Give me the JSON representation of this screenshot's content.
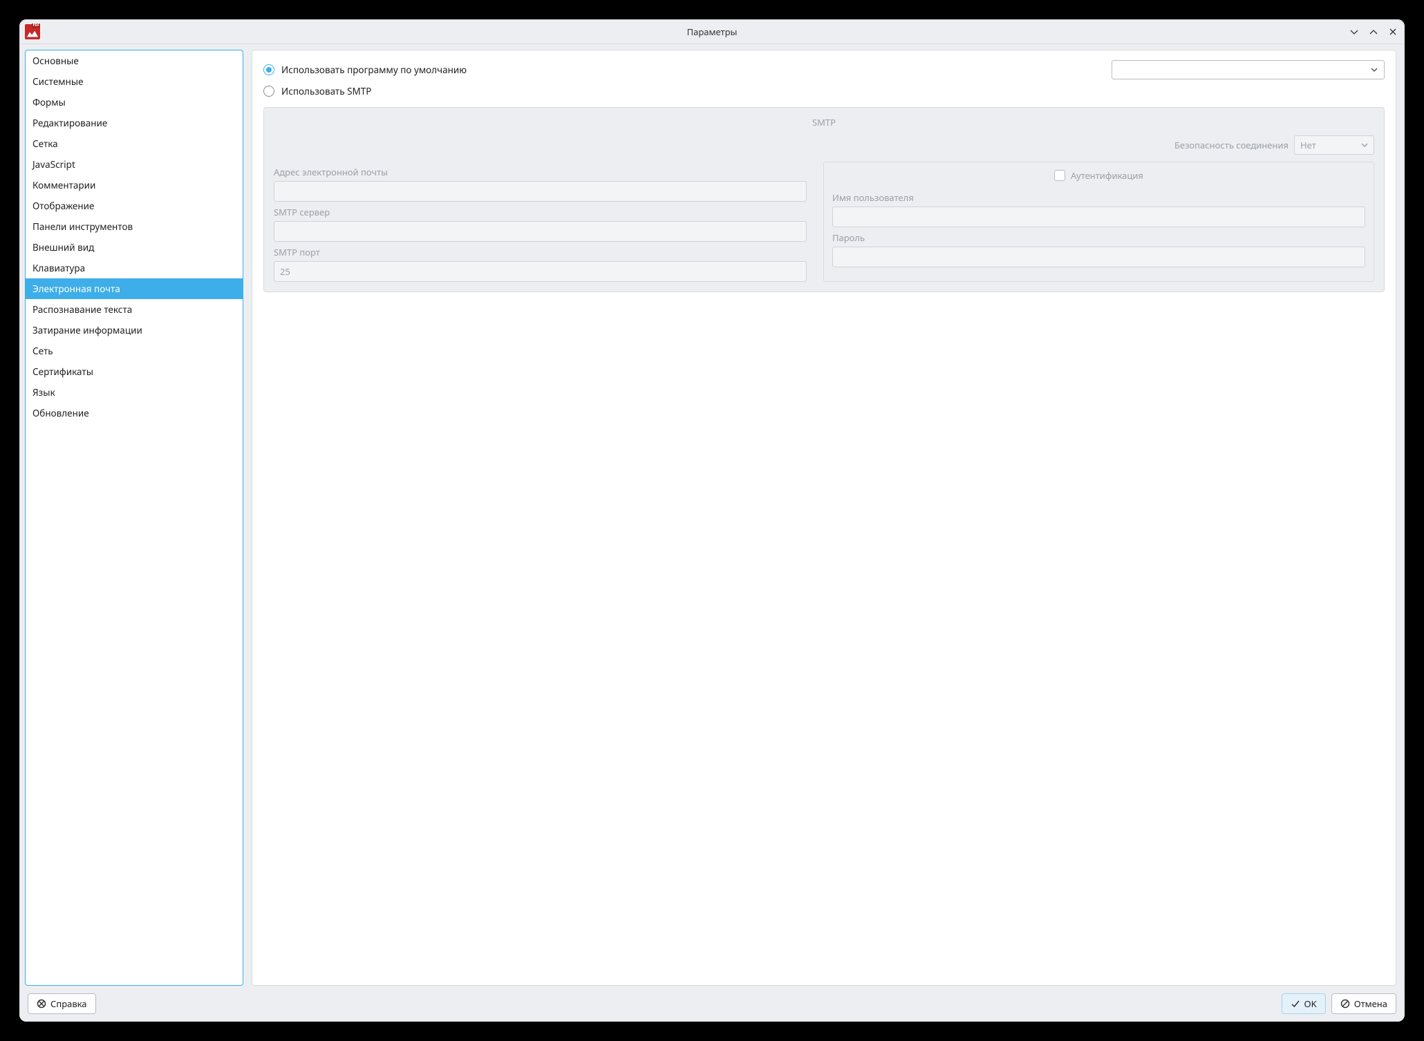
{
  "window": {
    "title": "Параметры"
  },
  "sidebar": {
    "items": [
      "Основные",
      "Системные",
      "Формы",
      "Редактирование",
      "Сетка",
      "JavaScript",
      "Комментарии",
      "Отображение",
      "Панели инструментов",
      "Внешний вид",
      "Клавиатура",
      "Электронная почта",
      "Распознавание текста",
      "Затирание информации",
      "Сеть",
      "Сертификаты",
      "Язык",
      "Обновление"
    ],
    "selected_index": 11
  },
  "email": {
    "radio_default": "Использовать программу по умолчанию",
    "radio_smtp": "Использовать SMTP",
    "selected_radio": "default",
    "default_program_value": "",
    "smtp": {
      "group_title": "SMTP",
      "security_label": "Безопасность соединения",
      "security_value": "Нет",
      "email_label": "Адрес электронной почты",
      "email_value": "",
      "server_label": "SMTP сервер",
      "server_value": "",
      "port_label": "SMTP порт",
      "port_value": "25",
      "auth_label": "Аутентификация",
      "auth_checked": false,
      "username_label": "Имя пользователя",
      "username_value": "",
      "password_label": "Пароль",
      "password_value": ""
    }
  },
  "footer": {
    "help": "Справка",
    "ok": "OK",
    "cancel": "Отмена"
  }
}
